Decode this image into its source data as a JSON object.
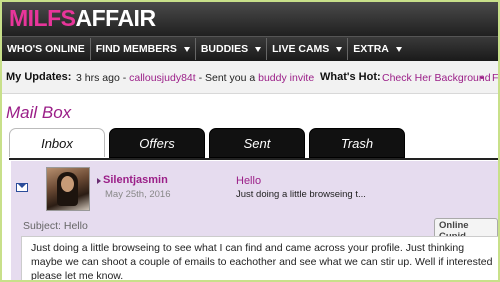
{
  "logo": {
    "part1": "MILFS",
    "part2": "AFFAIR"
  },
  "nav": [
    {
      "label": "WHO'S ONLINE",
      "has_caret": false
    },
    {
      "label": "FIND MEMBERS",
      "has_caret": true
    },
    {
      "label": "BUDDIES",
      "has_caret": true
    },
    {
      "label": "LIVE CAMS",
      "has_caret": true
    },
    {
      "label": "EXTRA",
      "has_caret": true
    }
  ],
  "updates": {
    "label": "My Updates:",
    "time": "3 hrs ago - ",
    "user": "callousjudy84t",
    "middle": " - Sent you a ",
    "link": "buddy invite",
    "hot_label": "What's Hot:",
    "hot_link": "Check Her Background",
    "bullet": "•",
    "trail": "F"
  },
  "mailbox": {
    "title": "Mail Box"
  },
  "tabs": [
    {
      "label": "Inbox",
      "active": true
    },
    {
      "label": "Offers",
      "active": false
    },
    {
      "label": "Sent",
      "active": false
    },
    {
      "label": "Trash",
      "active": false
    }
  ],
  "message": {
    "sender": "Silentjasmin",
    "date": "May 25th, 2016",
    "subject": "Hello",
    "preview": "Just doing a little browseing t...",
    "subject_line": "Subject: Hello",
    "badge": "Online Cupid",
    "body": "Just doing a little browseing to see what I can find and came across your profile. Just thinking maybe we can shoot a couple of emails to eachother and see what we can stir up. Well if interested please let me know."
  },
  "colors": {
    "brand": "#e8359a",
    "link": "#9b1f88",
    "panel": "#e6dcef"
  }
}
